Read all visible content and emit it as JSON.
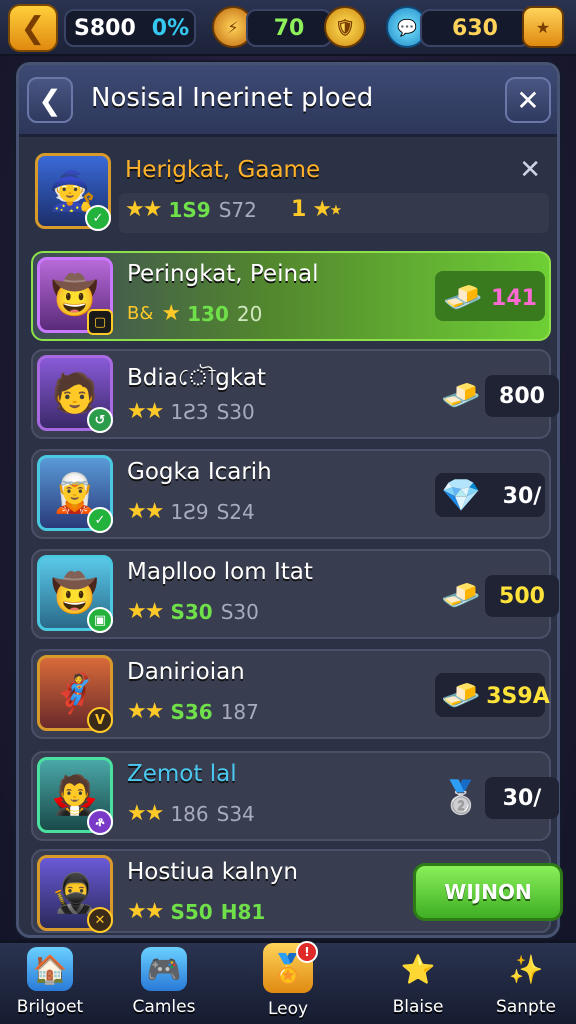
{
  "topbar": {
    "gold_value": "S800",
    "percent": "0%",
    "gems_value": "70",
    "tickets_value": "630"
  },
  "panel": {
    "title": "Nosisal Inerinet ploed"
  },
  "rows": [
    {
      "name": "Herigkat, Gaame",
      "s1": "1S9",
      "s2": "S72",
      "rank": "1",
      "avatar": "🧙",
      "badge_color": "#23b23c"
    },
    {
      "name": "Peringkat, Peinal",
      "s1": "130",
      "s2": "20",
      "prefix": "B&",
      "reward": "141",
      "avatar": "🤠",
      "badge_color": "#1a1a1a",
      "reward_color": "#ff6ad5"
    },
    {
      "name": "Bdiaৌgkat",
      "s1": "1Ƨ3",
      "s2": "S30",
      "reward": "800",
      "avatar": "🧑",
      "badge_color": "#2a9c4a",
      "reward_color": "#ffffff"
    },
    {
      "name": "Gogka Icarih",
      "s1": "1Ƨ9",
      "s2": "S24",
      "reward": "30/",
      "avatar": "🧝",
      "badge_color": "#23b23c",
      "reward_color": "#ffffff"
    },
    {
      "name": "Maplloo lom Itat",
      "s1": "S30",
      "s2": "S30",
      "reward": "500",
      "avatar": "🤠",
      "badge_color": "#23b23c",
      "reward_color": "#ffe23a"
    },
    {
      "name": "Danirioian",
      "s1": "S36",
      "s2": "187",
      "reward": "3S9A",
      "avatar": "🦸",
      "badge_color": "#3a2a1a",
      "reward_color": "#ffe23a"
    },
    {
      "name": "Zemot lal",
      "s1": "186",
      "s2": "S34",
      "reward": "30/",
      "avatar": "🧛",
      "badge_color": "#7a3ac8",
      "reward_color": "#ffffff"
    },
    {
      "name": "Hostiua kalnyn",
      "s1": "S50",
      "s2": "H81",
      "button": "WIJNON",
      "avatar": "🥷",
      "badge_color": "#3a2a1a"
    }
  ],
  "nav": [
    {
      "label": "Brilgoet",
      "icon": "house-icon",
      "glyph": "🏠"
    },
    {
      "label": "Camles",
      "icon": "chest-icon",
      "glyph": "🎮"
    },
    {
      "label": "Leoy",
      "icon": "badge-icon",
      "glyph": "🏅",
      "notif": "!"
    },
    {
      "label": "Blaise",
      "icon": "star-icon",
      "glyph": "⭐"
    },
    {
      "label": "Sanpte",
      "icon": "sparkle-icon",
      "glyph": "✨"
    }
  ],
  "colors": {
    "accent": "#ffc928",
    "highlight": "#6fcf35",
    "panel": "#2c3246"
  }
}
